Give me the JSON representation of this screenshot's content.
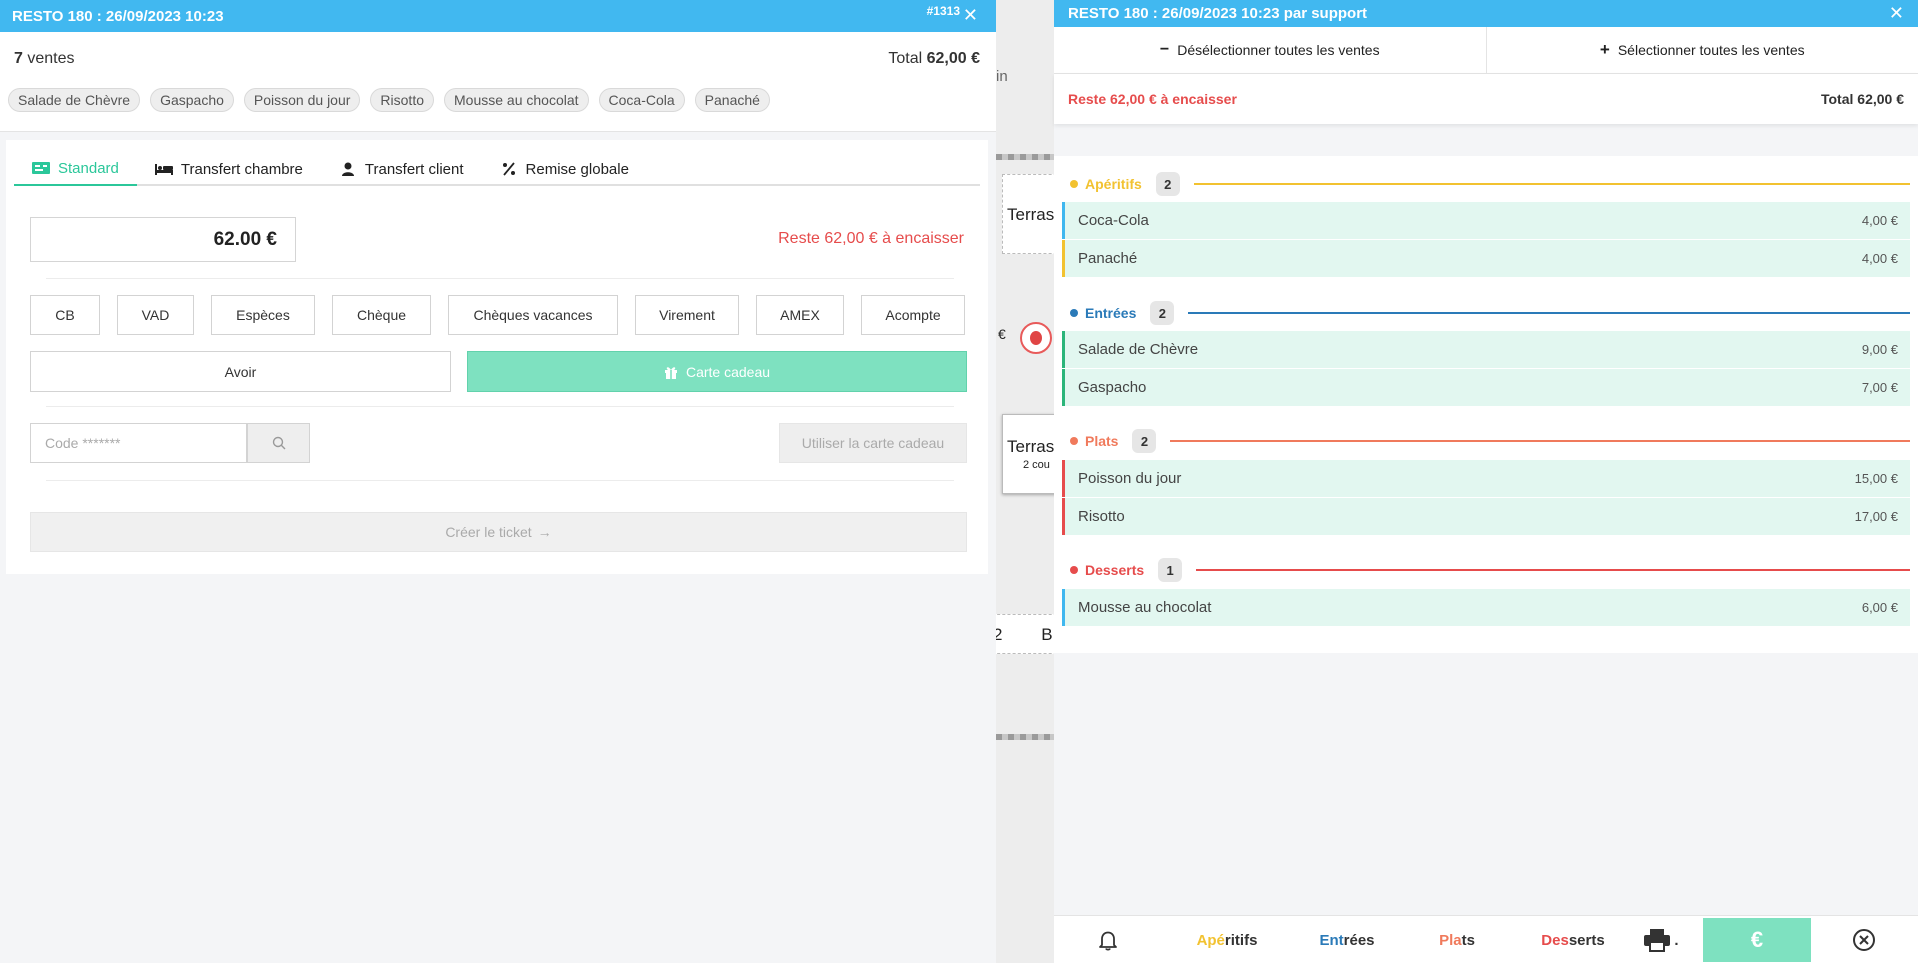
{
  "left_panel": {
    "header_title": "RESTO 180 : 26/09/2023 10:23",
    "ticket_number": "#1313",
    "sales_count": "7",
    "sales_label": "ventes",
    "total_label": "Total",
    "total_value": "62,00 €",
    "chips": [
      "Salade de Chèvre",
      "Gaspacho",
      "Poisson du jour",
      "Risotto",
      "Mousse au chocolat",
      "Coca-Cola",
      "Panaché"
    ],
    "tabs": [
      {
        "label": "Standard",
        "icon": "ticket-icon",
        "active": true
      },
      {
        "label": "Transfert chambre",
        "icon": "bed-icon",
        "active": false
      },
      {
        "label": "Transfert client",
        "icon": "user-icon",
        "active": false
      },
      {
        "label": "Remise globale",
        "icon": "percent-icon",
        "active": false
      }
    ],
    "amount": "62.00 €",
    "remaining": "Reste 62,00 € à encaisser",
    "payment_methods": [
      "CB",
      "VAD",
      "Espèces",
      "Chèque",
      "Chèques vacances",
      "Virement",
      "AMEX",
      "Acompte"
    ],
    "avoir_label": "Avoir",
    "gift_card_label": "Carte cadeau",
    "code_placeholder": "Code *******",
    "use_gift_card_label": "Utiliser la carte cadeau",
    "create_ticket_label": "Créer le ticket"
  },
  "background": {
    "tab_text": "in",
    "table_1": "Terrass",
    "table_2": "Terrass",
    "table_2_sub": "2 cou",
    "num_left": "2",
    "num_right": "B.",
    "partial_char": "€"
  },
  "right_panel": {
    "header_title": "RESTO 180 : 26/09/2023 10:23 par support",
    "deselect_all": "Désélectionner toutes les ventes",
    "select_all": "Sélectionner toutes les ventes",
    "remaining": "Reste 62,00 € à encaisser",
    "total": "Total 62,00 €",
    "categories": [
      {
        "name": "Apéritifs",
        "count": "2",
        "color": "#f2c230",
        "items": [
          {
            "name": "Coca-Cola",
            "price": "4,00 €",
            "bar": "#3fb7ef"
          },
          {
            "name": "Panaché",
            "price": "4,00 €",
            "bar": "#f2c230"
          }
        ]
      },
      {
        "name": "Entrées",
        "count": "2",
        "color": "#2a7ab8",
        "items": [
          {
            "name": "Salade de Chèvre",
            "price": "9,00 €",
            "bar": "#2bb57a"
          },
          {
            "name": "Gaspacho",
            "price": "7,00 €",
            "bar": "#2bb57a"
          }
        ]
      },
      {
        "name": "Plats",
        "count": "2",
        "color": "#f07a5c",
        "items": [
          {
            "name": "Poisson du jour",
            "price": "15,00 €",
            "bar": "#e64c4c"
          },
          {
            "name": "Risotto",
            "price": "17,00 €",
            "bar": "#e64c4c"
          }
        ]
      },
      {
        "name": "Desserts",
        "count": "1",
        "color": "#e64c4c",
        "items": [
          {
            "name": "Mousse au chocolat",
            "price": "6,00 €",
            "bar": "#3fb7ef"
          }
        ]
      }
    ],
    "bottom_bar": {
      "aperitifs_hi": "Apé",
      "aperitifs_rest": "ritifs",
      "entrees_hi": "Ent",
      "entrees_rest": "rées",
      "plats_hi": "Pla",
      "plats_rest": "ts",
      "desserts_hi": "Des",
      "desserts_rest": "serts",
      "print_suffix": ".",
      "euro": "€"
    }
  },
  "colors": {
    "header_blue": "#41b8f0",
    "accent_green": "#2bc79a",
    "pay_green": "#7ee1c0",
    "alert_red": "#e64c4c"
  }
}
